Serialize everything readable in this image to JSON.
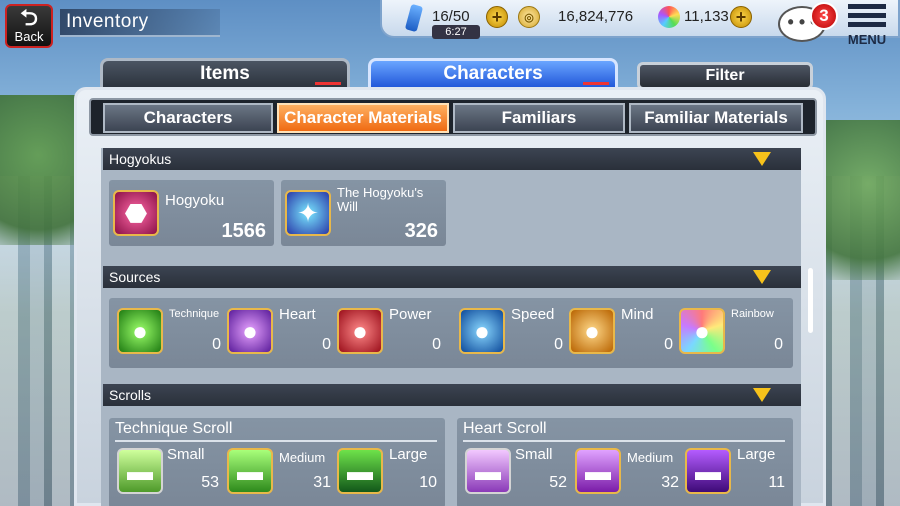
{
  "header": {
    "back_label": "Back",
    "title": "Inventory"
  },
  "resources": {
    "stamina": "16/50",
    "timer": "6:27",
    "coins": "16,824,776",
    "spirit_orbs": "11,133",
    "notifications": "3",
    "menu_label": "MENU",
    "chat_glyph": "• • •"
  },
  "main_tabs": [
    {
      "label": "Items"
    },
    {
      "label": "Characters"
    }
  ],
  "filter_label": "Filter",
  "sub_tabs": [
    {
      "label": "Characters"
    },
    {
      "label": "Character Materials"
    },
    {
      "label": "Familiars"
    },
    {
      "label": "Familiar Materials"
    }
  ],
  "sections": {
    "hogyokus": {
      "title": "Hogyokus",
      "items": [
        {
          "name": "Hogyoku",
          "qty": "1566"
        },
        {
          "name": "The Hogyoku's Will",
          "qty": "326"
        }
      ]
    },
    "sources": {
      "title": "Sources",
      "items": [
        {
          "name": "Technique",
          "qty": "0"
        },
        {
          "name": "Heart",
          "qty": "0"
        },
        {
          "name": "Power",
          "qty": "0"
        },
        {
          "name": "Speed",
          "qty": "0"
        },
        {
          "name": "Mind",
          "qty": "0"
        },
        {
          "name": "Rainbow",
          "qty": "0"
        }
      ]
    },
    "scrolls": {
      "title": "Scrolls",
      "technique": {
        "title": "Technique Scroll",
        "items": [
          {
            "name": "Small",
            "qty": "53"
          },
          {
            "name": "Medium",
            "qty": "31"
          },
          {
            "name": "Large",
            "qty": "10"
          }
        ]
      },
      "heart": {
        "title": "Heart Scroll",
        "items": [
          {
            "name": "Small",
            "qty": "52"
          },
          {
            "name": "Medium",
            "qty": "32"
          },
          {
            "name": "Large",
            "qty": "11"
          }
        ]
      }
    }
  },
  "colors": {
    "active_tab": "#ef6a12",
    "accent_blue": "#1f55d8",
    "badge_red": "#d00000",
    "arrow_yellow": "#f7c21b"
  },
  "icons": [
    "back-arrow-icon",
    "stamina-icon",
    "plus-icon",
    "coin-icon",
    "spirit-orb-icon",
    "chat-icon",
    "menu-icon",
    "dropdown-arrow-icon"
  ]
}
